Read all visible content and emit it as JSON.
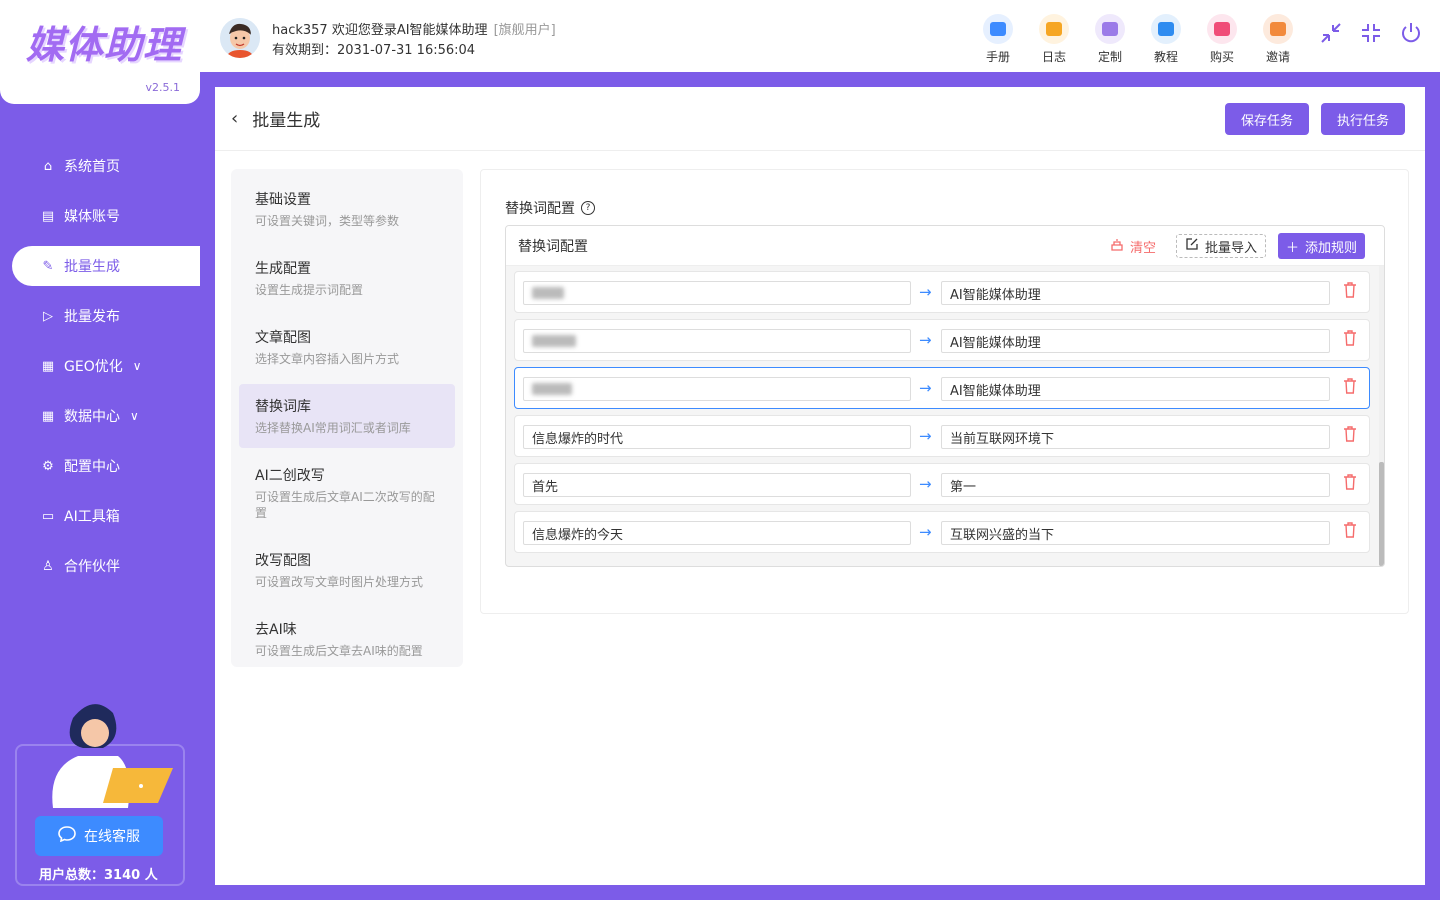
{
  "app": {
    "logo": "媒体助理",
    "version": "v2.5.1"
  },
  "sidebar": {
    "items": [
      {
        "label": "系统首页",
        "icon": "home-icon"
      },
      {
        "label": "媒体账号",
        "icon": "account-icon"
      },
      {
        "label": "批量生成",
        "icon": "edit-icon"
      },
      {
        "label": "批量发布",
        "icon": "send-icon"
      },
      {
        "label": "GEO优化",
        "icon": "doc-icon"
      },
      {
        "label": "数据中心",
        "icon": "doc-icon"
      },
      {
        "label": "配置中心",
        "icon": "gear-icon"
      },
      {
        "label": "AI工具箱",
        "icon": "book-icon"
      },
      {
        "label": "合作伙伴",
        "icon": "partner-icon"
      }
    ],
    "active_index": 2,
    "customer_service": "在线客服",
    "user_count": "用户总数：3140 人"
  },
  "header": {
    "greeting": "hack357 欢迎您登录AI智能媒体助理",
    "tier": "[旗舰用户]",
    "expire": "有效期到：2031-07-31 16:56:04",
    "tools": [
      {
        "label": "手册",
        "color": "#3d8bff",
        "bg": "#e6f0ff"
      },
      {
        "label": "日志",
        "color": "#f6a623",
        "bg": "#fff3df"
      },
      {
        "label": "定制",
        "color": "#9b7be8",
        "bg": "#efe9fc"
      },
      {
        "label": "教程",
        "color": "#2f8cf0",
        "bg": "#e3f0fd"
      },
      {
        "label": "购买",
        "color": "#f04d78",
        "bg": "#fde6ee"
      },
      {
        "label": "邀请",
        "color": "#f28a3c",
        "bg": "#fdeadd"
      }
    ]
  },
  "page": {
    "title": "批量生成",
    "save_label": "保存任务",
    "run_label": "执行任务"
  },
  "steps": [
    {
      "title": "基础设置",
      "desc": "可设置关键词，类型等参数"
    },
    {
      "title": "生成配置",
      "desc": "设置生成提示词配置"
    },
    {
      "title": "文章配图",
      "desc": "选择文章内容插入图片方式"
    },
    {
      "title": "替换词库",
      "desc": "选择替换AI常用词汇或者词库"
    },
    {
      "title": "AI二创改写",
      "desc": "可设置生成后文章AI二次改写的配置"
    },
    {
      "title": "改写配图",
      "desc": "可设置改写文章时图片处理方式"
    },
    {
      "title": "去AI味",
      "desc": "可设置生成后文章去AI味的配置"
    }
  ],
  "active_step": 3,
  "replace_config": {
    "section_label": "替换词配置",
    "box_title": "替换词配置",
    "clear_label": "清空",
    "import_label": "批量导入",
    "add_label": "添加规则",
    "rules": [
      {
        "src": "",
        "dst": "AI智能媒体助理"
      },
      {
        "src": "",
        "dst": "AI智能媒体助理"
      },
      {
        "src": "",
        "dst": "AI智能媒体助理"
      },
      {
        "src": "信息爆炸的时代",
        "dst": "当前互联网环境下"
      },
      {
        "src": "首先",
        "dst": "第一"
      },
      {
        "src": "信息爆炸的今天",
        "dst": "互联网兴盛的当下"
      }
    ],
    "focused_row": 2
  }
}
